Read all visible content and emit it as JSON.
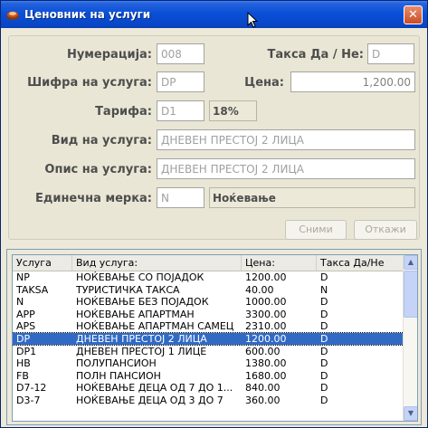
{
  "window": {
    "title": "Ценовник на услуги",
    "close_label": "✕"
  },
  "form": {
    "numeracija_label": "Нумерација:",
    "numeracija_value": "008",
    "taksa_label": "Такса Да / Не:",
    "taksa_value": "D",
    "sifra_label": "Шифра на услуга:",
    "sifra_value": "DP",
    "cena_label": "Цена:",
    "cena_value": "1,200.00",
    "tarifa_label": "Тарифа:",
    "tarifa_value": "D1",
    "tarifa_percent": "18%",
    "vid_label": "Вид на услуга:",
    "vid_value": "ДНЕВЕН ПРЕСТОЈ 2 ЛИЦА",
    "opis_label": "Опис на услуга:",
    "opis_value": "ДНЕВЕН ПРЕСТОЈ 2 ЛИЦА",
    "merka_label": "Единечна мерка:",
    "merka_value": "N",
    "merka_name": "Ноќевање"
  },
  "buttons": {
    "save": "Сними",
    "cancel": "Откажи"
  },
  "grid": {
    "columns": [
      "Услуга",
      "Вид услуга:",
      "Цена:",
      "Такса Да/Не"
    ],
    "rows": [
      [
        "NP",
        "НОЌЕВАЊЕ СО ПОЈАДОК",
        "1200.00",
        "D"
      ],
      [
        "TAKSA",
        "ТУРИСТИЧКА ТАКСА",
        "40.00",
        "N"
      ],
      [
        "N",
        "НОЌЕВАЊЕ БЕЗ ПОЈАДОК",
        "1000.00",
        "D"
      ],
      [
        "APP",
        "НОЌЕВАЊЕ АПАРТМАН",
        "3300.00",
        "D"
      ],
      [
        "APS",
        "НОЌЕВАЊЕ АПАРТМАН САМЕЦ",
        "2310.00",
        "D"
      ],
      [
        "DP",
        "ДНЕВЕН ПРЕСТОЈ 2 ЛИЦА",
        "1200.00",
        "D"
      ],
      [
        "DP1",
        "ДНЕВЕН ПРЕСТОЈ 1 ЛИЦЕ",
        "600.00",
        "D"
      ],
      [
        "HB",
        "ПОЛУПАНСИОН",
        "1380.00",
        "D"
      ],
      [
        "FB",
        "ПОЛН ПАНСИОН",
        "1680.00",
        "D"
      ],
      [
        "D7-12",
        "НОЌЕВАЊЕ ДЕЦА ОД 7 ДО 1...",
        "840.00",
        "D"
      ],
      [
        "D3-7",
        "НОЌЕВАЊЕ ДЕЦА ОД 3 ДО 7",
        "360.00",
        "D"
      ]
    ],
    "selected_index": 5
  },
  "colors": {
    "selection": "#316AC5",
    "titlebar": "#0A50D8"
  },
  "icons": {
    "app": "app-icon",
    "cursor": "mouse-cursor-icon",
    "scroll_up": "chevron-up-icon",
    "scroll_down": "chevron-down-icon"
  }
}
